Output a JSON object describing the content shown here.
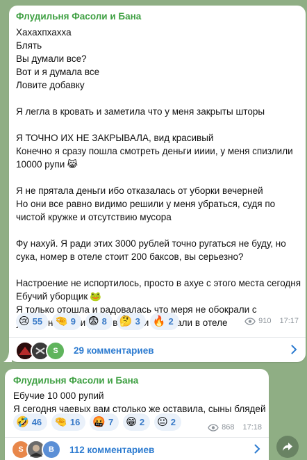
{
  "post1": {
    "author": "Флудильня Фасоли и Бана",
    "lines": [
      "Хахахпхахха",
      "Блять",
      "Вы думали все?",
      "Вот и я думала все",
      "Ловите добавку",
      "",
      "Я легла в кровать и заметила что у меня закрыты шторы",
      "",
      "Я ТОЧНО ИХ НЕ ЗАКРЫВАЛА, вид красивый",
      "Конечно я сразу пошла смотреть деньги ииии, у меня спизлили",
      "10000 рупи",
      "",
      "Я не прятала деньги ибо отказалась от уборки вечерней",
      "Но они все равно видимо решили у меня убраться, судя по",
      "чистой кружке и отсутствию мусора",
      "",
      "Фу нахуй. Я ради этих 3000 рублей точно ругаться не буду, но",
      "сука, номер в отеле стоит 200 баксов, вы серьезно?",
      "",
      "Настроение не испортилось, просто в ахуе с этого места сегодня",
      "Ебучий уборщик",
      "Я только отошла и радовалась что меря не обокрали с",
      "украшениями, и меня все таки обокрали в отеле"
    ],
    "emoji_after_line_10": "😹",
    "emoji_after_line_20": "🐸",
    "reactions": [
      {
        "emoji": "😢",
        "count": "55"
      },
      {
        "emoji": "🤏",
        "count": "9"
      },
      {
        "emoji": "😨",
        "count": "8"
      },
      {
        "emoji": "🤔",
        "count": "3"
      },
      {
        "emoji": "🔥",
        "count": "2"
      }
    ],
    "views": "910",
    "time": "17:17",
    "comments": "29 комментариев",
    "avatars": [
      "",
      "",
      "S"
    ]
  },
  "post2": {
    "author": "Флудильня Фасоли и Бана",
    "lines": [
      "Ебучие 10 000 рупий",
      "Я сегодня чаевых вам столько же оставила, сыны блядей"
    ],
    "reactions": [
      {
        "emoji": "🤣",
        "count": "46"
      },
      {
        "emoji": "🤏",
        "count": "16"
      },
      {
        "emoji": "🤬",
        "count": "7"
      },
      {
        "emoji": "😁",
        "count": "2"
      },
      {
        "emoji": "😐",
        "count": "2"
      }
    ],
    "views": "868",
    "time": "17:18",
    "comments": "112 комментариев",
    "avatars": [
      "S",
      "",
      "B"
    ]
  },
  "colors": {
    "background": "#8fae84",
    "author": "#3fa043",
    "link": "#2c7bd0",
    "reaction_bg": "#eaf1fa"
  }
}
